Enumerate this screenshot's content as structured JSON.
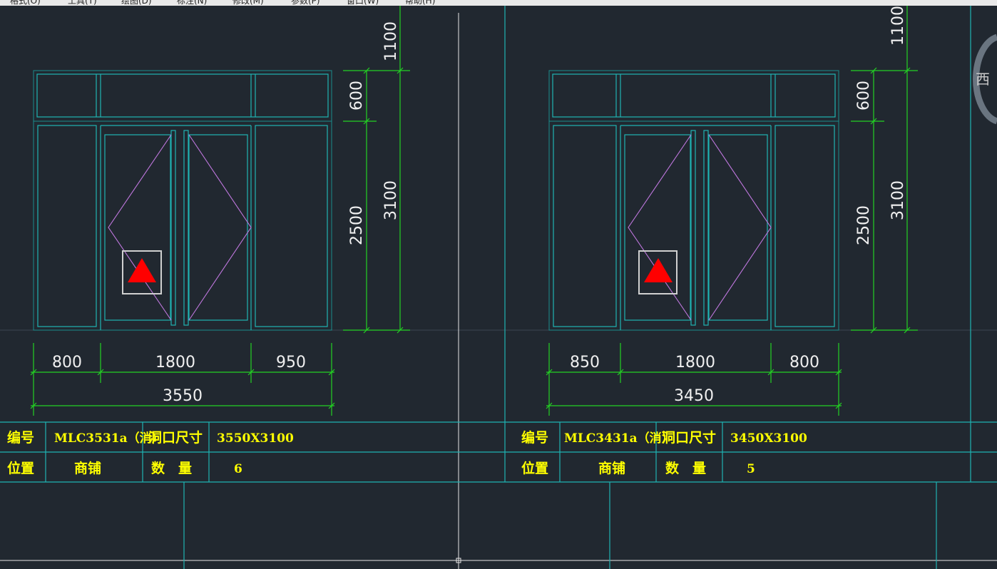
{
  "menu": [
    "格式(O)",
    "工具(T)",
    "绘图(D)",
    "标注(N)",
    "修改(M)",
    "参数(P)",
    "窗口(W)",
    "帮助(H)"
  ],
  "compass_label": "西",
  "doors": [
    {
      "id": "left",
      "dims": {
        "top_overall": "1100",
        "transom_h": "600",
        "door_h": "2500",
        "total_h": "3100",
        "w1": "800",
        "w2": "1800",
        "w3": "950",
        "total_w": "3550"
      },
      "table": {
        "code_label": "编号",
        "code_value": "MLC3531a（消）",
        "size_label": "洞口尺寸",
        "size_value": "3550X3100",
        "loc_label": "位置",
        "loc_value": "商铺",
        "qty_label": "数　量",
        "qty_value": "6"
      }
    },
    {
      "id": "right",
      "dims": {
        "top_overall": "1100",
        "transom_h": "600",
        "door_h": "2500",
        "total_h": "3100",
        "w1": "850",
        "w2": "1800",
        "w3": "800",
        "total_w": "3450"
      },
      "table": {
        "code_label": "编号",
        "code_value": "MLC3431a（消）",
        "size_label": "洞口尺寸",
        "size_value": "3450X3100",
        "loc_label": "位置",
        "loc_value": "商铺",
        "qty_label": "数　量",
        "qty_value": "5"
      }
    }
  ],
  "colors": {
    "background": "#212830",
    "frame": "#1fb3b3",
    "dimension": "#23d223",
    "swing": "#c178e0",
    "marker": "#ff0000",
    "table_text": "#ffff00"
  }
}
